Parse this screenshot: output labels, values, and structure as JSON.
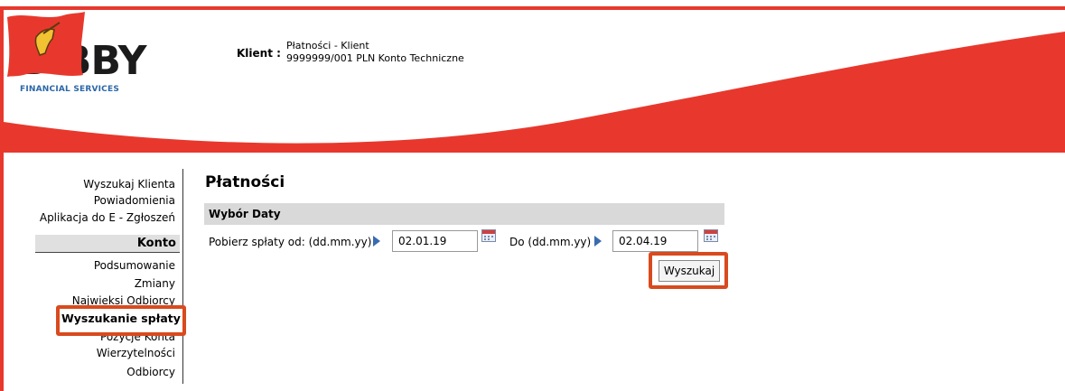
{
  "brand": {
    "name": "BIBBY",
    "subtitle": "FINANCIAL SERVICES"
  },
  "client": {
    "label": "Klient :",
    "line1": "Płatności - Klient",
    "line2": "9999999/001 PLN Konto Techniczne"
  },
  "sidebar": {
    "items_top": [
      "Wyszukaj Klienta",
      "Powiadomienia",
      "Aplikacja do E - Zgłoszeń"
    ],
    "section": "Konto",
    "items": [
      "Podsumowanie",
      "Zmiany",
      "Najwieksi Odbiorcy",
      "Wyszukanie spłaty",
      "Pozycje Konta",
      "Wierzytelności",
      "Odbiorcy"
    ],
    "active": "Wyszukanie spłaty"
  },
  "main": {
    "title": "Płatności",
    "panel_title": "Wybór Daty",
    "from_label": "Pobierz spłaty od: (dd.mm.yy)",
    "from_value": "02.01.19",
    "to_label": "Do (dd.mm.yy)",
    "to_value": "02.04.19",
    "search_button": "Wyszukaj"
  },
  "icons": {
    "arrow": "play-arrow-icon",
    "calendar": "calendar-icon",
    "flag": "lion-flag-icon"
  },
  "colors": {
    "brand_red": "#e8382d",
    "highlight": "#d94a1e",
    "arrow_blue": "#3a6bb0",
    "panel_grey": "#d9d9d9"
  }
}
